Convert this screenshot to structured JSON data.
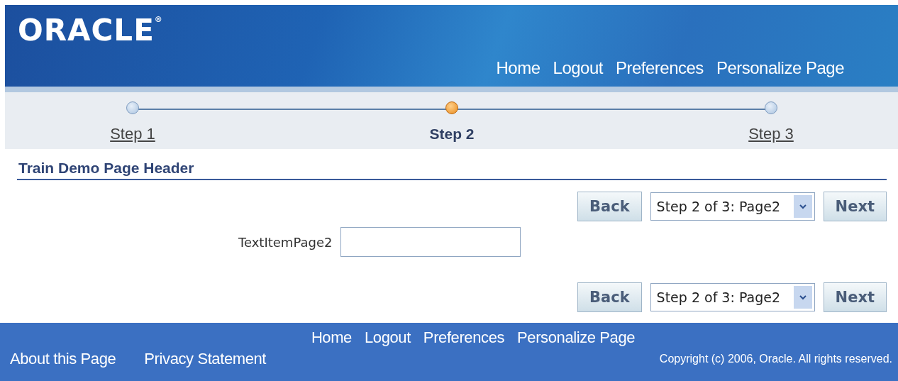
{
  "header": {
    "logo": "ORACLE$^{®}$",
    "global_links": [
      "Home",
      "Logout",
      "Preferences",
      "Personalize Page"
    ]
  },
  "train": [
    {
      "label": "Step 1",
      "selected": false
    },
    {
      "label": "Step 2",
      "selected": true
    },
    {
      "label": "Step 3",
      "selected": false
    }
  ],
  "page_header": "Train Demo Page Header",
  "nav_bars": [
    {
      "back": "Back",
      "step_choice": "Step 2 of 3: Page2",
      "next": "Next"
    },
    {
      "back": "Back",
      "step_choice": "Step 2 of 3: Page2",
      "next": "Next"
    }
  ],
  "form": {
    "label": "TextItemPage2"
  },
  "footer": {
    "global_links": [
      "Home",
      "Logout",
      "Preferences",
      "Personalize Page"
    ],
    "links": [
      "About this Page",
      "Privacy Statement"
    ],
    "copyright": "Copyright (c) 2006, Oracle. All rights reserved."
  }
}
